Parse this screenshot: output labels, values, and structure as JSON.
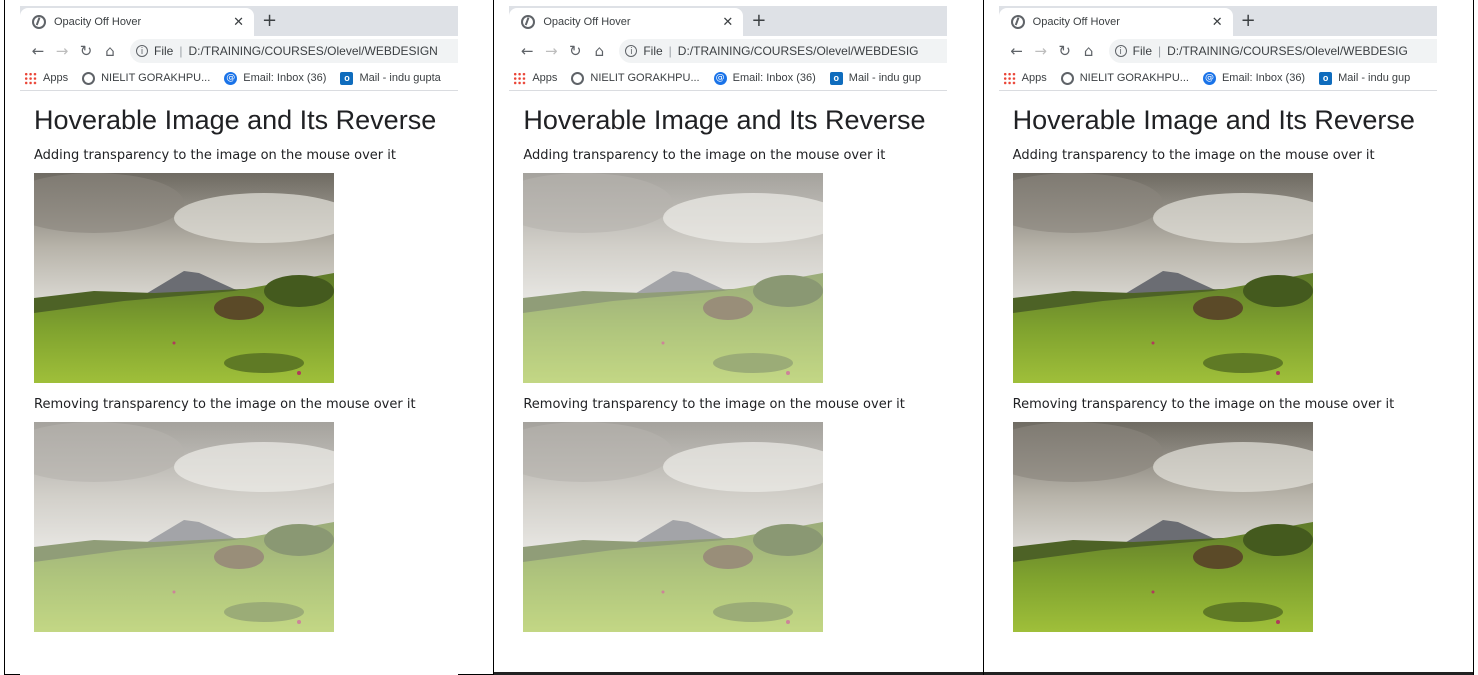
{
  "panels": [
    {
      "tab_title": "Opacity Off Hover",
      "url_prefix": "File",
      "url": "D:/TRAINING/COURSES/Olevel/WEBDESIGN",
      "bookmarks": [
        "Apps",
        "NIELIT GORAKHPU...",
        "Email: Inbox (36)",
        "Mail - indu gupta"
      ],
      "heading": "Hoverable Image and Its Reverse",
      "text1": "Adding transparency to the image on the mouse over it",
      "text2": "Removing transparency to the image on the mouse over it",
      "img1_state": "opaque",
      "img2_state": "faded"
    },
    {
      "tab_title": "Opacity Off Hover",
      "url_prefix": "File",
      "url": "D:/TRAINING/COURSES/Olevel/WEBDESIG",
      "bookmarks": [
        "Apps",
        "NIELIT GORAKHPU...",
        "Email: Inbox (36)",
        "Mail - indu gup"
      ],
      "heading": "Hoverable Image and Its Reverse",
      "text1": "Adding transparency to the image on the mouse over it",
      "text2": "Removing transparency to the image on the mouse over it",
      "img1_state": "faded",
      "img2_state": "faded"
    },
    {
      "tab_title": "Opacity Off Hover",
      "url_prefix": "File",
      "url": "D:/TRAINING/COURSES/Olevel/WEBDESIG",
      "bookmarks": [
        "Apps",
        "NIELIT GORAKHPU...",
        "Email: Inbox (36)",
        "Mail - indu gup"
      ],
      "heading": "Hoverable Image and Its Reverse",
      "text1": "Adding transparency to the image on the mouse over it",
      "text2": "Removing transparency to the image on the mouse over it",
      "img1_state": "opaque",
      "img2_state": "opaque"
    }
  ],
  "colors": {
    "tabstrip": "#dee1e6",
    "omnibox": "#f1f3f4",
    "text": "#202124"
  }
}
